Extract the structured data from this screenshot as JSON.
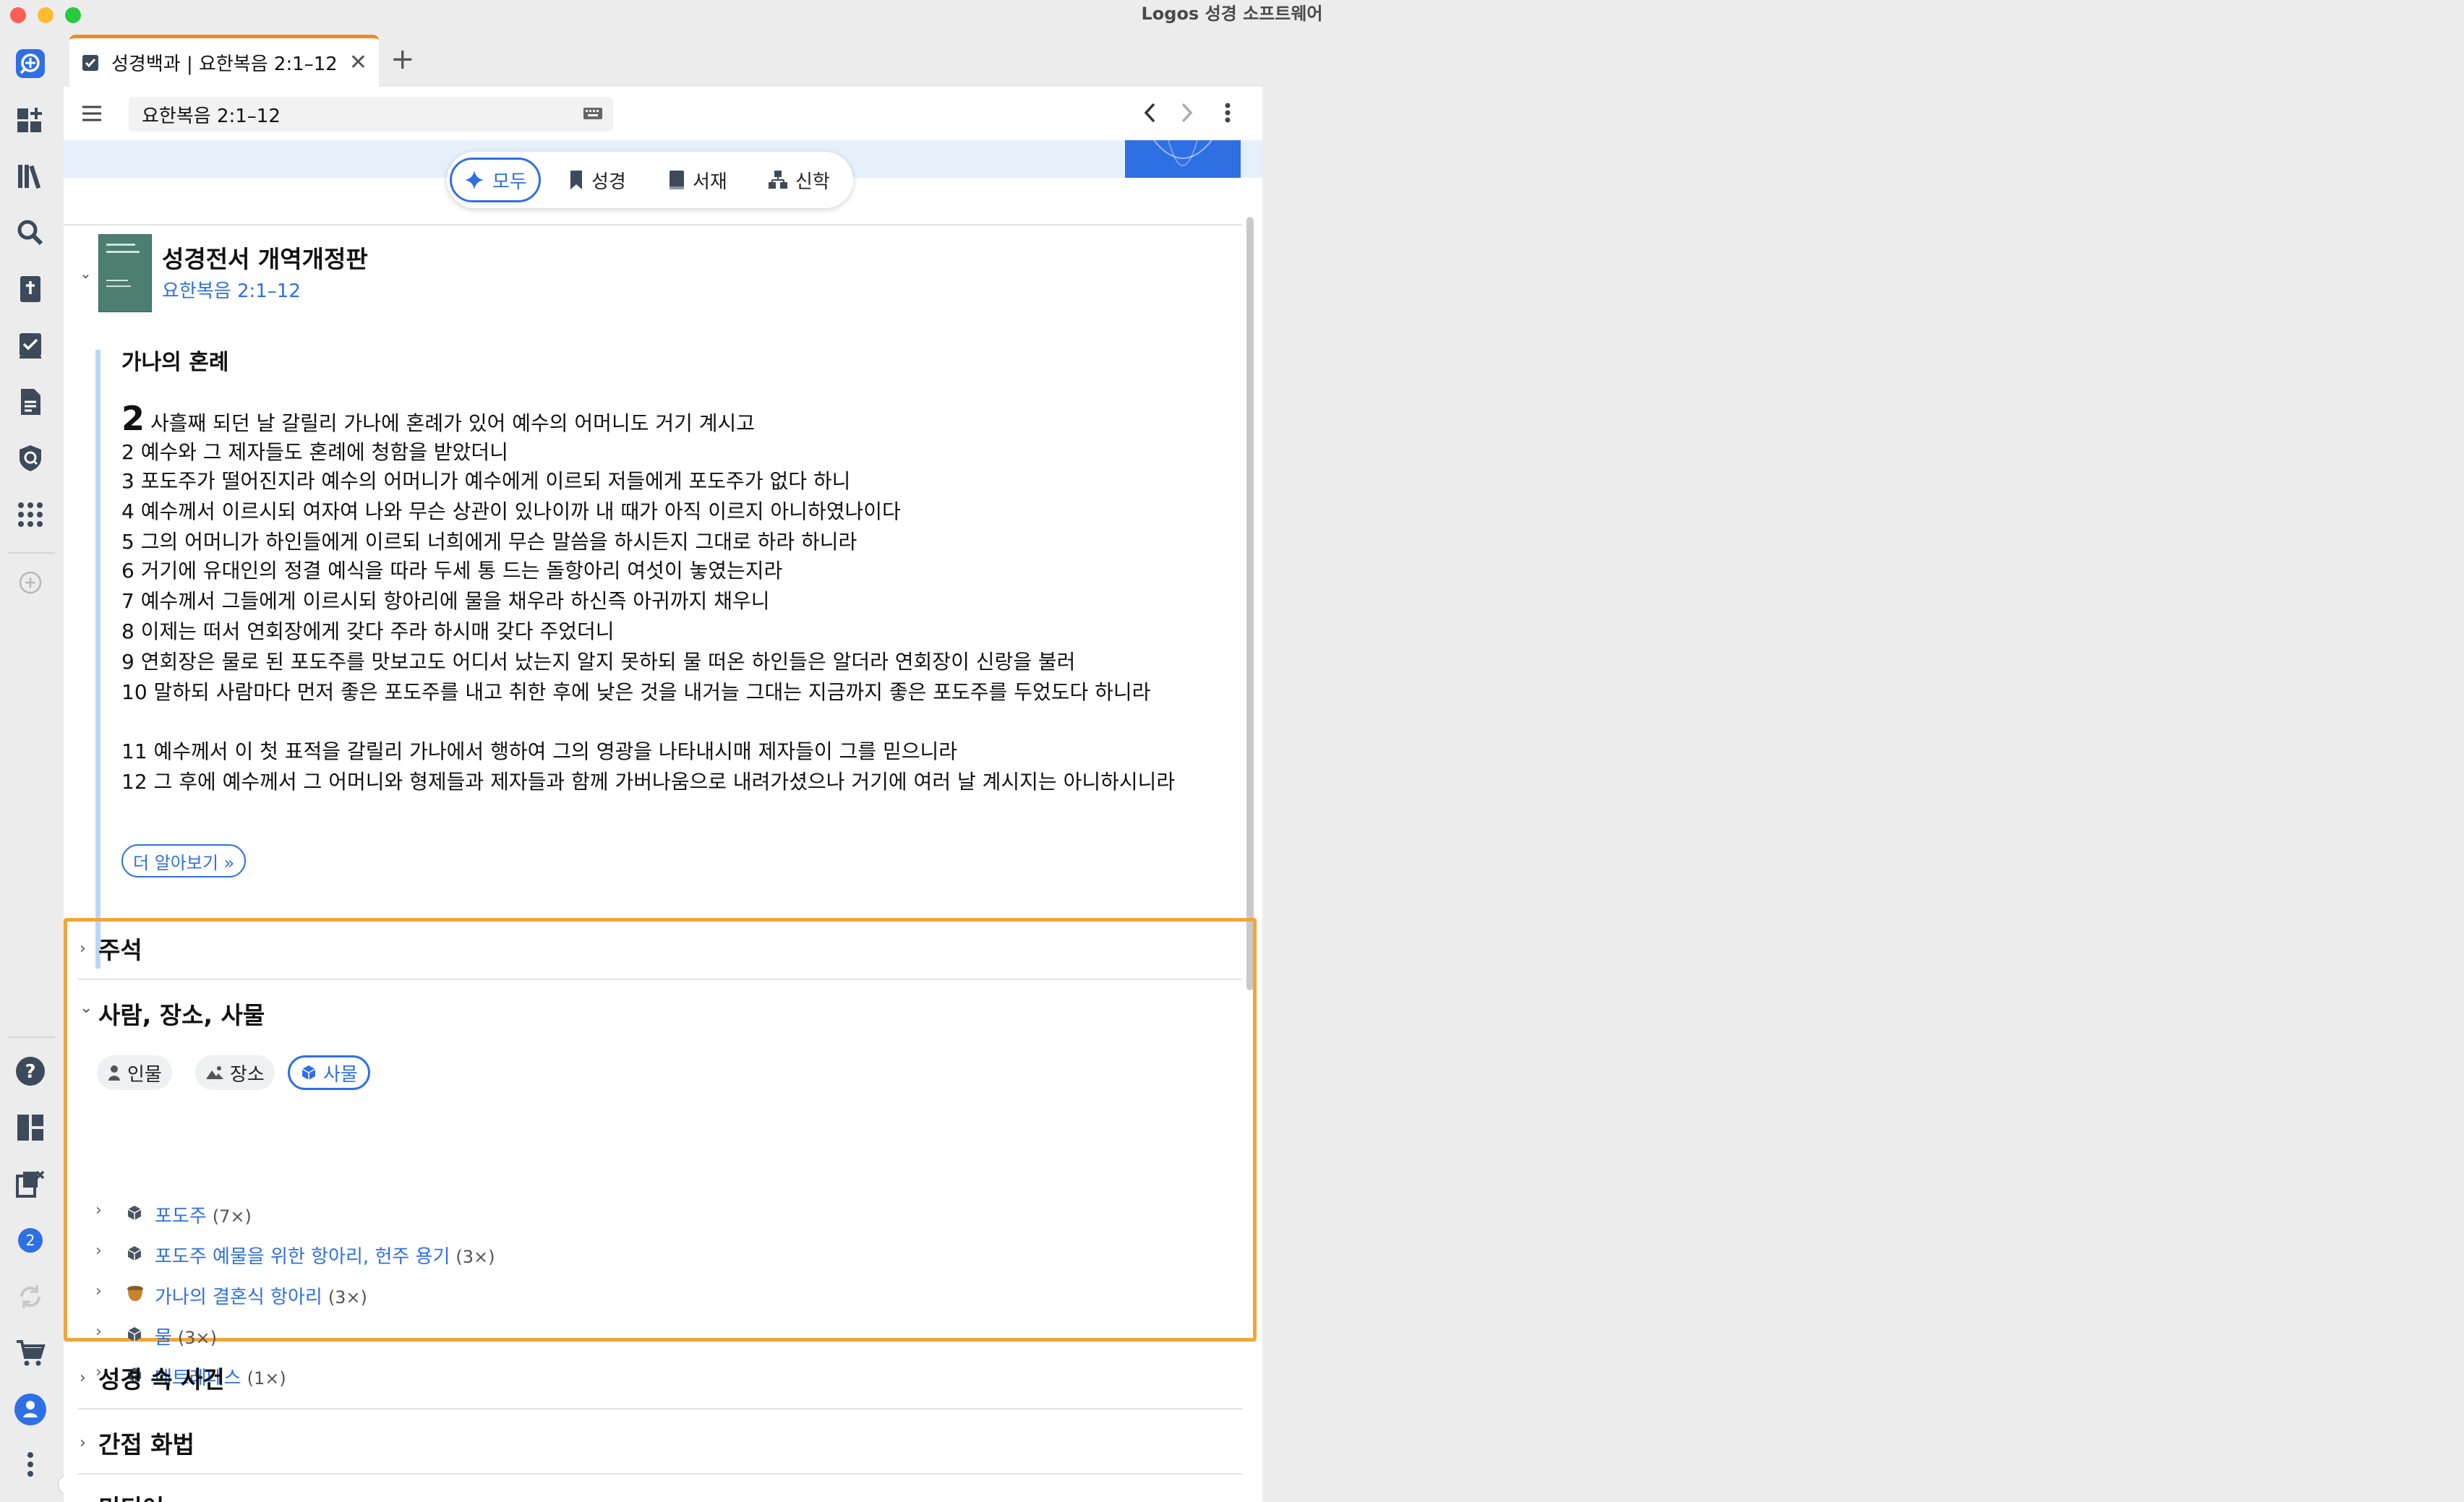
{
  "window": {
    "title": "Logos 성경 소프트웨어"
  },
  "tab": {
    "label": "성경백과 | 요한복음 2:1–12",
    "close": "✕",
    "add": "+"
  },
  "toolbar": {
    "reference": "요한복음 2:1–12"
  },
  "filters": [
    {
      "label": "모두",
      "icon": "sparkle-icon",
      "active": true
    },
    {
      "label": "성경",
      "icon": "bookmark-icon",
      "active": false
    },
    {
      "label": "서재",
      "icon": "book-icon",
      "active": false
    },
    {
      "label": "신학",
      "icon": "hierarchy-icon",
      "active": false
    }
  ],
  "bible": {
    "title": "성경전서 개역개정판",
    "reference": "요한복음 2:1–12",
    "pericope": "가나의 혼례",
    "chapter": "2",
    "first_verse": "사흘째 되던 날 갈릴리 가나에 혼례가 있어 예수의 어머니도 거기 계시고",
    "verses": [
      "2 예수와 그 제자들도 혼례에 청함을 받았더니",
      "3 포도주가 떨어진지라 예수의 어머니가 예수에게 이르되 저들에게 포도주가 없다 하니",
      "4 예수께서 이르시되 여자여 나와 무슨 상관이 있나이까 내 때가 아직 이르지 아니하였나이다",
      "5 그의 어머니가 하인들에게 이르되 너희에게 무슨 말씀을 하시든지 그대로 하라 하니라",
      "6 거기에 유대인의 정결 예식을 따라 두세 통 드는 돌항아리 여섯이 놓였는지라",
      "7 예수께서 그들에게 이르시되 항아리에 물을 채우라 하신즉 아귀까지 채우니",
      "8 이제는 떠서 연회장에게 갖다 주라 하시매 갖다 주었더니",
      "9 연회장은 물로 된 포도주를 맛보고도 어디서 났는지 알지 못하되 물 떠온 하인들은 알더라 연회장이 신랑을 불러",
      "10 말하되 사람마다 먼저 좋은 포도주를 내고 취한 후에 낮은 것을 내거늘 그대는 지금까지 좋은 포도주를 두었도다 하니라",
      "11 예수께서 이 첫 표적을 갈릴리 가나에서 행하여 그의 영광을 나타내시매 제자들이 그를 믿으니라",
      "12 그 후에 예수께서 그 어머니와 형제들과 제자들과 함께 가버나움으로 내려가셨으나 거기에 여러 날 계시지는 아니하시니라"
    ],
    "more_label": "더 알아보기 »"
  },
  "sections": {
    "notes": "주석",
    "ppt": "사람, 장소, 사물",
    "events": "성경 속 사건",
    "figures": "간접 화법",
    "media": "미디어"
  },
  "chips": [
    {
      "label": "인물",
      "icon": "person-icon",
      "active": false
    },
    {
      "label": "장소",
      "icon": "landscape-icon",
      "active": false
    },
    {
      "label": "사물",
      "icon": "cube-icon",
      "active": true
    }
  ],
  "things": [
    {
      "name": "포도주",
      "count": "(7×)",
      "icon": "cube-icon"
    },
    {
      "name": "포도주 예물을 위한 항아리, 헌주 용기",
      "count": "(3×)",
      "icon": "cube-icon"
    },
    {
      "name": "가나의 결혼식 항아리",
      "count": "(3×)",
      "icon": "jar-icon"
    },
    {
      "name": "물",
      "count": "(3×)",
      "icon": "cube-icon"
    },
    {
      "name": "메트레테스",
      "count": "(1×)",
      "icon": "cube-icon"
    }
  ],
  "rail": {
    "badge": "2"
  },
  "colors": {
    "accent": "#2f6fe4",
    "highlight": "#f0a63a",
    "tab_border": "#f08a24"
  }
}
